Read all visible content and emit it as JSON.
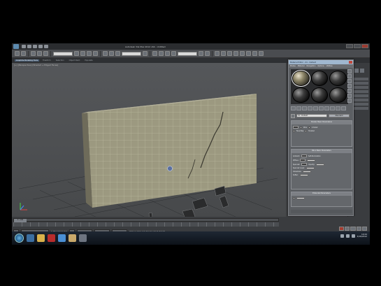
{
  "window": {
    "title": "Autodesk 3ds Max 2012 x64 - Untitled"
  },
  "ribbon": {
    "tabs": [
      "Graphite Modeling Tools",
      "Freeform",
      "Selection",
      "Object Paint",
      "Populate"
    ]
  },
  "viewport": {
    "label": "[+] [Perspective] [Shaded + Edged Faces]"
  },
  "material_editor": {
    "title": "Material Editor - 01 - Default",
    "menus": [
      "Modes",
      "Material",
      "Navigation",
      "Options",
      "Utilities"
    ],
    "material_name": "01 - Default",
    "material_type": "Standard",
    "rollouts": {
      "shader_basic": "Shader Basic Parameters",
      "blinn_basic": "Blinn Basic Parameters",
      "extended": "Extended Parameters"
    },
    "labels": {
      "wire": "Wire",
      "two_sided": "2-Sided",
      "face_map": "Face Map",
      "faceted": "Faceted",
      "ambient": "Ambient:",
      "diffuse": "Diffuse:",
      "specular": "Specular:",
      "self_illum": "Self-Illumination",
      "opacity": "Opacity:",
      "specular_level": "Specular Level:",
      "glossiness": "Glossiness:",
      "soften": "Soften:"
    }
  },
  "timeline": {
    "current": "0 / 100"
  },
  "status": {
    "selection": "1 Object Selected",
    "prompt": "Click or click-and-drag to select objects"
  },
  "taskbar": {
    "time": "10:24",
    "date": "3/18/2012"
  },
  "colors": {
    "viewport_bg": "#515355",
    "ui_panel": "#3a3c3f",
    "taskbar": "#0d1219",
    "wall_texture": "#9c9980",
    "selection_highlight": "#9fb7cf"
  }
}
